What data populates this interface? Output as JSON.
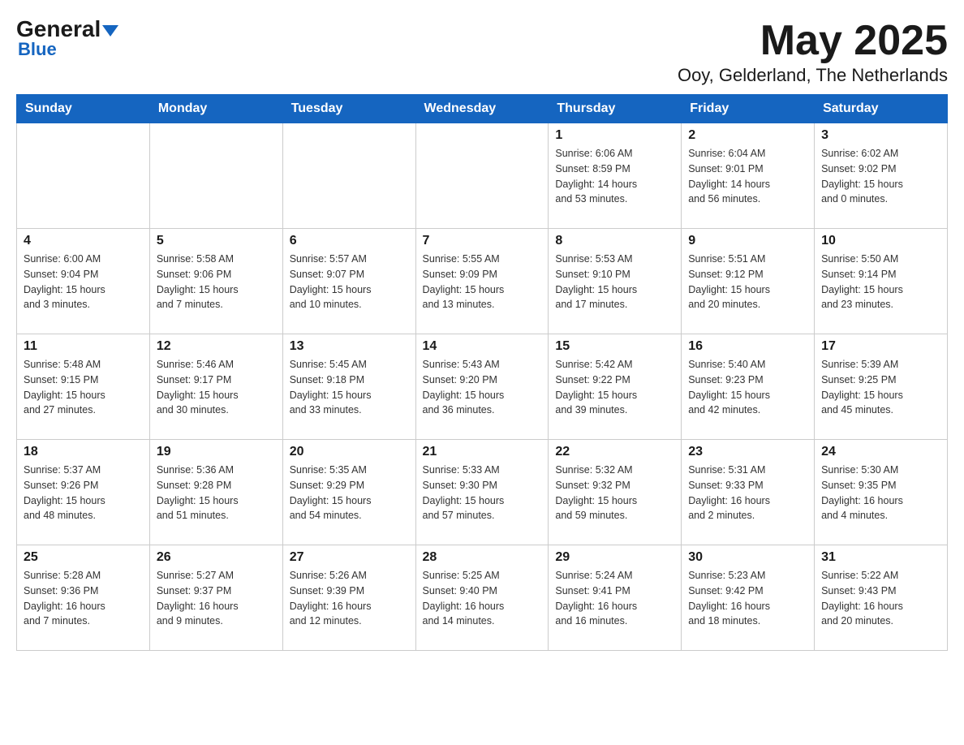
{
  "header": {
    "logo": {
      "general": "General",
      "blue": "Blue"
    },
    "title": "May 2025",
    "subtitle": "Ooy, Gelderland, The Netherlands"
  },
  "weekdays": [
    "Sunday",
    "Monday",
    "Tuesday",
    "Wednesday",
    "Thursday",
    "Friday",
    "Saturday"
  ],
  "weeks": [
    [
      {
        "day": "",
        "info": ""
      },
      {
        "day": "",
        "info": ""
      },
      {
        "day": "",
        "info": ""
      },
      {
        "day": "",
        "info": ""
      },
      {
        "day": "1",
        "info": "Sunrise: 6:06 AM\nSunset: 8:59 PM\nDaylight: 14 hours\nand 53 minutes."
      },
      {
        "day": "2",
        "info": "Sunrise: 6:04 AM\nSunset: 9:01 PM\nDaylight: 14 hours\nand 56 minutes."
      },
      {
        "day": "3",
        "info": "Sunrise: 6:02 AM\nSunset: 9:02 PM\nDaylight: 15 hours\nand 0 minutes."
      }
    ],
    [
      {
        "day": "4",
        "info": "Sunrise: 6:00 AM\nSunset: 9:04 PM\nDaylight: 15 hours\nand 3 minutes."
      },
      {
        "day": "5",
        "info": "Sunrise: 5:58 AM\nSunset: 9:06 PM\nDaylight: 15 hours\nand 7 minutes."
      },
      {
        "day": "6",
        "info": "Sunrise: 5:57 AM\nSunset: 9:07 PM\nDaylight: 15 hours\nand 10 minutes."
      },
      {
        "day": "7",
        "info": "Sunrise: 5:55 AM\nSunset: 9:09 PM\nDaylight: 15 hours\nand 13 minutes."
      },
      {
        "day": "8",
        "info": "Sunrise: 5:53 AM\nSunset: 9:10 PM\nDaylight: 15 hours\nand 17 minutes."
      },
      {
        "day": "9",
        "info": "Sunrise: 5:51 AM\nSunset: 9:12 PM\nDaylight: 15 hours\nand 20 minutes."
      },
      {
        "day": "10",
        "info": "Sunrise: 5:50 AM\nSunset: 9:14 PM\nDaylight: 15 hours\nand 23 minutes."
      }
    ],
    [
      {
        "day": "11",
        "info": "Sunrise: 5:48 AM\nSunset: 9:15 PM\nDaylight: 15 hours\nand 27 minutes."
      },
      {
        "day": "12",
        "info": "Sunrise: 5:46 AM\nSunset: 9:17 PM\nDaylight: 15 hours\nand 30 minutes."
      },
      {
        "day": "13",
        "info": "Sunrise: 5:45 AM\nSunset: 9:18 PM\nDaylight: 15 hours\nand 33 minutes."
      },
      {
        "day": "14",
        "info": "Sunrise: 5:43 AM\nSunset: 9:20 PM\nDaylight: 15 hours\nand 36 minutes."
      },
      {
        "day": "15",
        "info": "Sunrise: 5:42 AM\nSunset: 9:22 PM\nDaylight: 15 hours\nand 39 minutes."
      },
      {
        "day": "16",
        "info": "Sunrise: 5:40 AM\nSunset: 9:23 PM\nDaylight: 15 hours\nand 42 minutes."
      },
      {
        "day": "17",
        "info": "Sunrise: 5:39 AM\nSunset: 9:25 PM\nDaylight: 15 hours\nand 45 minutes."
      }
    ],
    [
      {
        "day": "18",
        "info": "Sunrise: 5:37 AM\nSunset: 9:26 PM\nDaylight: 15 hours\nand 48 minutes."
      },
      {
        "day": "19",
        "info": "Sunrise: 5:36 AM\nSunset: 9:28 PM\nDaylight: 15 hours\nand 51 minutes."
      },
      {
        "day": "20",
        "info": "Sunrise: 5:35 AM\nSunset: 9:29 PM\nDaylight: 15 hours\nand 54 minutes."
      },
      {
        "day": "21",
        "info": "Sunrise: 5:33 AM\nSunset: 9:30 PM\nDaylight: 15 hours\nand 57 minutes."
      },
      {
        "day": "22",
        "info": "Sunrise: 5:32 AM\nSunset: 9:32 PM\nDaylight: 15 hours\nand 59 minutes."
      },
      {
        "day": "23",
        "info": "Sunrise: 5:31 AM\nSunset: 9:33 PM\nDaylight: 16 hours\nand 2 minutes."
      },
      {
        "day": "24",
        "info": "Sunrise: 5:30 AM\nSunset: 9:35 PM\nDaylight: 16 hours\nand 4 minutes."
      }
    ],
    [
      {
        "day": "25",
        "info": "Sunrise: 5:28 AM\nSunset: 9:36 PM\nDaylight: 16 hours\nand 7 minutes."
      },
      {
        "day": "26",
        "info": "Sunrise: 5:27 AM\nSunset: 9:37 PM\nDaylight: 16 hours\nand 9 minutes."
      },
      {
        "day": "27",
        "info": "Sunrise: 5:26 AM\nSunset: 9:39 PM\nDaylight: 16 hours\nand 12 minutes."
      },
      {
        "day": "28",
        "info": "Sunrise: 5:25 AM\nSunset: 9:40 PM\nDaylight: 16 hours\nand 14 minutes."
      },
      {
        "day": "29",
        "info": "Sunrise: 5:24 AM\nSunset: 9:41 PM\nDaylight: 16 hours\nand 16 minutes."
      },
      {
        "day": "30",
        "info": "Sunrise: 5:23 AM\nSunset: 9:42 PM\nDaylight: 16 hours\nand 18 minutes."
      },
      {
        "day": "31",
        "info": "Sunrise: 5:22 AM\nSunset: 9:43 PM\nDaylight: 16 hours\nand 20 minutes."
      }
    ]
  ]
}
